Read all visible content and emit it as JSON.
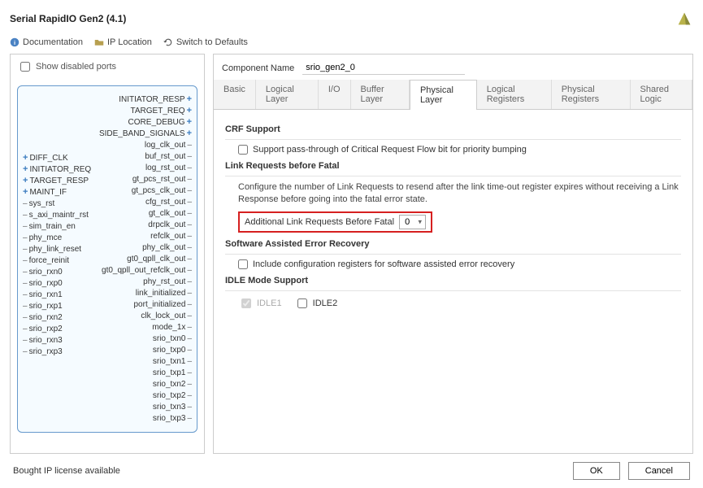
{
  "header": {
    "title": "Serial RapidIO Gen2 (4.1)"
  },
  "toolbar": {
    "documentation": "Documentation",
    "ip_location": "IP Location",
    "switch_defaults": "Switch to Defaults"
  },
  "left": {
    "show_disabled_label": "Show disabled ports",
    "left_ports_top": [
      {
        "label": "DIFF_CLK",
        "plus": true
      },
      {
        "label": "INITIATOR_REQ",
        "plus": true
      },
      {
        "label": "TARGET_RESP",
        "plus": true
      },
      {
        "label": "MAINT_IF",
        "plus": true
      }
    ],
    "left_ports_bottom": [
      "sys_rst",
      "s_axi_maintr_rst",
      "sim_train_en",
      "phy_mce",
      "phy_link_reset",
      "force_reinit",
      "srio_rxn0",
      "srio_rxp0",
      "srio_rxn1",
      "srio_rxp1",
      "srio_rxn2",
      "srio_rxp2",
      "srio_rxn3",
      "srio_rxp3"
    ],
    "right_ports_top": [
      {
        "label": "INITIATOR_RESP",
        "plus": true
      },
      {
        "label": "TARGET_REQ",
        "plus": true
      },
      {
        "label": "CORE_DEBUG",
        "plus": true
      },
      {
        "label": "SIDE_BAND_SIGNALS",
        "plus": true
      }
    ],
    "right_ports_bottom": [
      "log_clk_out",
      "buf_rst_out",
      "log_rst_out",
      "gt_pcs_rst_out",
      "gt_pcs_clk_out",
      "cfg_rst_out",
      "gt_clk_out",
      "drpclk_out",
      "refclk_out",
      "phy_clk_out",
      "gt0_qpll_clk_out",
      "gt0_qpll_out_refclk_out",
      "phy_rst_out",
      "link_initialized",
      "port_initialized",
      "clk_lock_out",
      "mode_1x",
      "srio_txn0",
      "srio_txp0",
      "srio_txn1",
      "srio_txp1",
      "srio_txn2",
      "srio_txp2",
      "srio_txn3",
      "srio_txp3"
    ]
  },
  "right": {
    "component_name_label": "Component Name",
    "component_name_value": "srio_gen2_0",
    "tabs": [
      "Basic",
      "Logical Layer",
      "I/O",
      "Buffer Layer",
      "Physical Layer",
      "Logical Registers",
      "Physical Registers",
      "Shared Logic"
    ],
    "active_tab": "Physical Layer",
    "crf": {
      "title": "CRF Support",
      "check_label": "Support pass-through of Critical Request Flow bit for priority bumping"
    },
    "link_req": {
      "title": "Link Requests before Fatal",
      "desc": "Configure the number of Link Requests to resend after the link time-out register expires without receiving a Link Response before going into the fatal error state.",
      "field_label": "Additional Link Requests Before Fatal",
      "field_value": "0"
    },
    "sw_err": {
      "title": "Software Assisted Error Recovery",
      "check_label": "Include configuration registers for software assisted error recovery"
    },
    "idle": {
      "title": "IDLE Mode Support",
      "idle1": "IDLE1",
      "idle2": "IDLE2"
    }
  },
  "footer": {
    "license": "Bought IP license available",
    "ok": "OK",
    "cancel": "Cancel"
  }
}
